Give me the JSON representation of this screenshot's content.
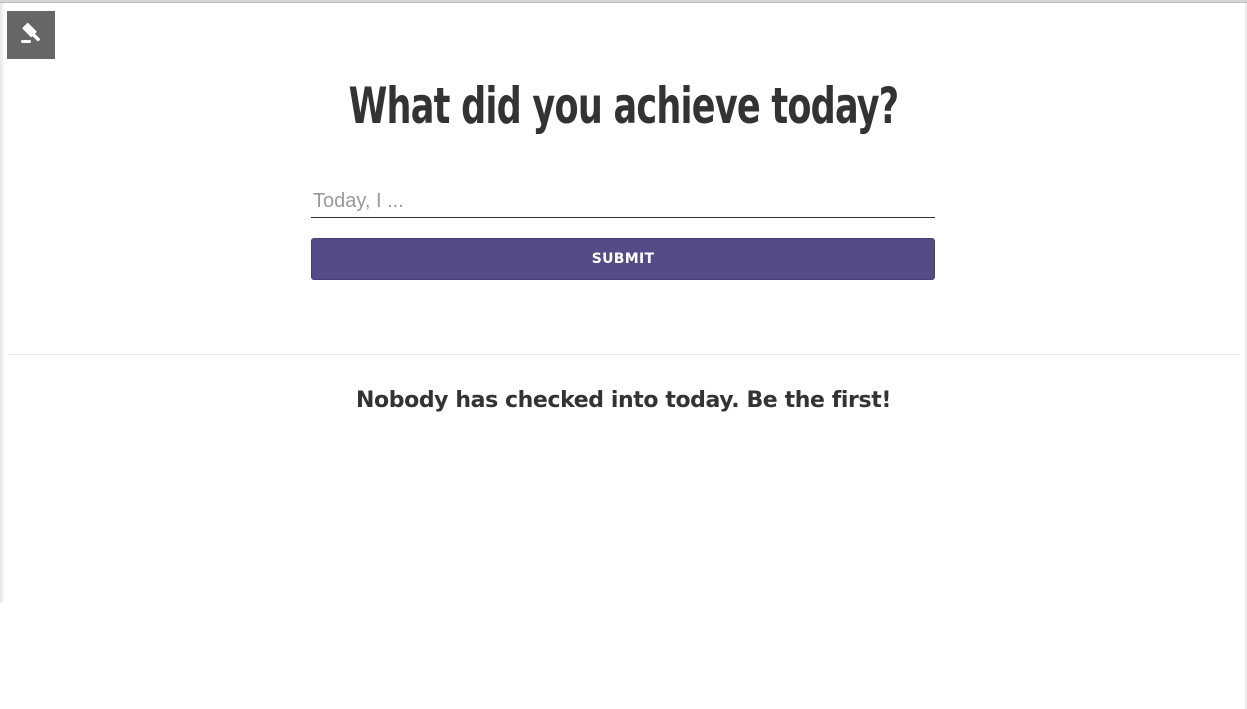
{
  "toolbar": {
    "tool_icon": "gavel-icon"
  },
  "main": {
    "title": "What did you achieve today?",
    "input_placeholder": "Today, I ...",
    "input_value": "",
    "submit_label": "SUBMIT"
  },
  "feed": {
    "empty_message": "Nobody has checked into today. Be the first!"
  },
  "colors": {
    "accent": "#554c87",
    "text": "#333333",
    "tool_button": "#666666"
  }
}
